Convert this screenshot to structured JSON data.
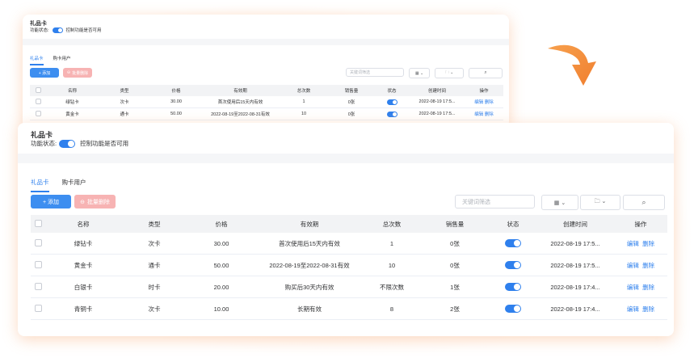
{
  "page": {
    "title": "礼品卡",
    "status_label": "功能状态:",
    "status_hint": "控制功能是否可用",
    "tabs": [
      {
        "label": "礼品卡",
        "active": true
      },
      {
        "label": "购卡用户",
        "active": false
      }
    ],
    "add_button": "+ 添加",
    "batch_delete_button": "批量删除",
    "search_placeholder": "关键词筛选",
    "columns": [
      "名称",
      "类型",
      "价格",
      "有效期",
      "总次数",
      "销售量",
      "状态",
      "创建时间",
      "操作"
    ],
    "actions": {
      "edit": "编辑",
      "delete": "删除"
    }
  },
  "small_rows": [
    {
      "name": "绿钻卡",
      "type": "次卡",
      "price": "30.00",
      "validity": "首次使用后15天内有效",
      "total": "1",
      "sales": "0张",
      "created": "2022-08-19 17:5..."
    },
    {
      "name": "黄金卡",
      "type": "通卡",
      "price": "50.00",
      "validity": "2022-08-19至2022-08-31有效",
      "total": "10",
      "sales": "0张",
      "created": "2022-08-19 17:5..."
    }
  ],
  "rows": [
    {
      "name": "绿钻卡",
      "type": "次卡",
      "price": "30.00",
      "validity": "首次使用后15天内有效",
      "total": "1",
      "sales": "0张",
      "created": "2022-08-19 17:5..."
    },
    {
      "name": "黄金卡",
      "type": "通卡",
      "price": "50.00",
      "validity": "2022-08-19至2022-08-31有效",
      "total": "10",
      "sales": "0张",
      "created": "2022-08-19 17:5..."
    },
    {
      "name": "白银卡",
      "type": "时卡",
      "price": "20.00",
      "validity": "购买后30天内有效",
      "total": "不限次数",
      "sales": "1张",
      "created": "2022-08-19 17:4..."
    },
    {
      "name": "青铜卡",
      "type": "次卡",
      "price": "10.00",
      "validity": "长期有效",
      "total": "8",
      "sales": "2张",
      "created": "2022-08-19 17:4..."
    }
  ],
  "colors": {
    "accent": "#2f80ed",
    "arrow": "#f4943f",
    "danger_light": "#f7b3b3"
  },
  "icons": [
    "grid-icon",
    "folder-icon",
    "chevron-down-icon",
    "search-icon",
    "curved-arrow-icon"
  ]
}
